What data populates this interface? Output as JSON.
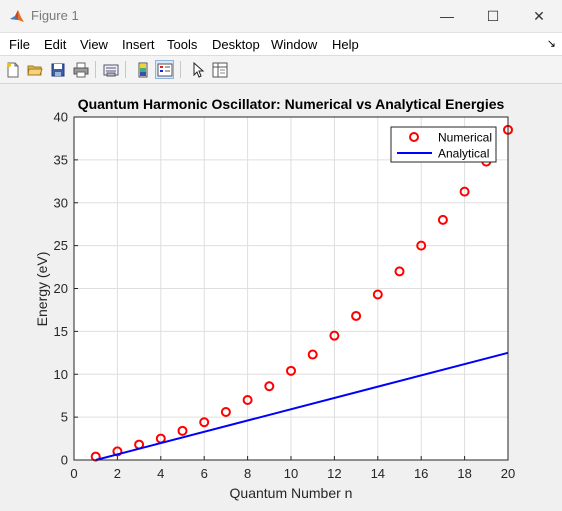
{
  "window": {
    "title": "Figure 1",
    "controls": {
      "minimize": "—",
      "maximize": "☐",
      "close": "✕"
    }
  },
  "menu": {
    "items": [
      "File",
      "Edit",
      "View",
      "Insert",
      "Tools",
      "Desktop",
      "Window",
      "Help"
    ],
    "dock_glyph": "↘"
  },
  "toolbar": {
    "buttons": [
      "new-figure-icon",
      "open-file-icon",
      "save-icon",
      "print-icon",
      "link-plot-icon",
      "colorbar-icon",
      "legend-icon",
      "pointer-icon",
      "property-inspector-icon"
    ]
  },
  "colors": {
    "numerical": "#ff0000",
    "analytical": "#0000ff",
    "axes_bg": "#ffffff",
    "figure_bg": "#f0f0f0"
  },
  "chart_data": {
    "type": "line",
    "title": "Quantum Harmonic Oscillator: Numerical vs Analytical Energies",
    "xlabel": "Quantum Number n",
    "ylabel": "Energy (eV)",
    "xlim": [
      0,
      20
    ],
    "ylim": [
      0,
      40
    ],
    "xticks": [
      0,
      2,
      4,
      6,
      8,
      10,
      12,
      14,
      16,
      18,
      20
    ],
    "yticks": [
      0,
      5,
      10,
      15,
      20,
      25,
      30,
      35,
      40
    ],
    "grid": true,
    "legend_position": "top-right",
    "series": [
      {
        "name": "Numerical",
        "style": "markers",
        "marker": "circle",
        "color": "#ff0000",
        "x": [
          1,
          2,
          3,
          4,
          5,
          6,
          7,
          8,
          9,
          10,
          11,
          12,
          13,
          14,
          15,
          16,
          17,
          18,
          19,
          20
        ],
        "y": [
          0.4,
          1.0,
          1.8,
          2.5,
          3.4,
          4.4,
          5.6,
          7.0,
          8.6,
          10.4,
          12.3,
          14.5,
          16.8,
          19.3,
          22.0,
          25.0,
          28.0,
          31.3,
          34.8,
          38.5
        ]
      },
      {
        "name": "Analytical",
        "style": "line",
        "color": "#0000ff",
        "x": [
          1,
          20
        ],
        "y": [
          0.0,
          12.5
        ]
      }
    ]
  }
}
